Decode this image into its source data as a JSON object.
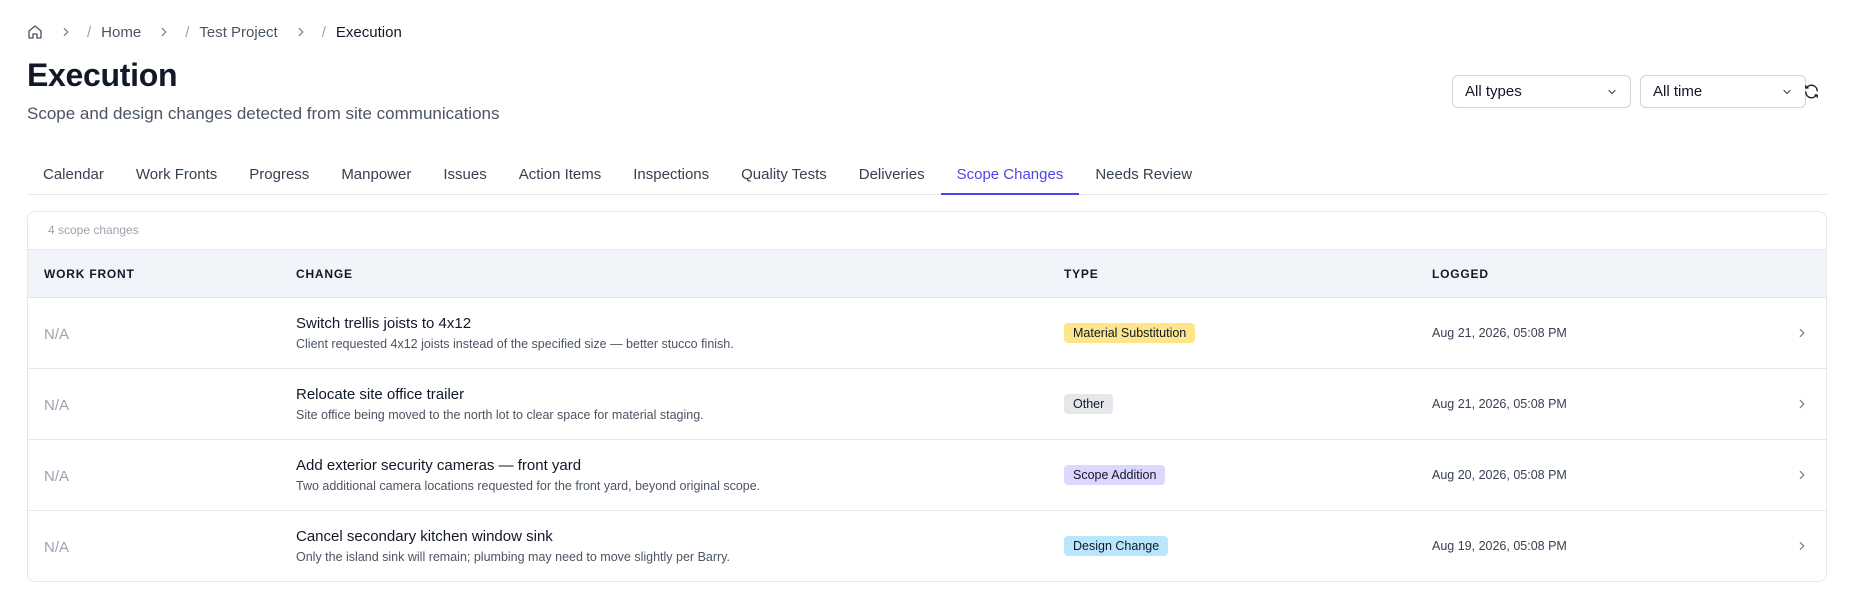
{
  "breadcrumb": {
    "items": [
      {
        "label": "Home"
      },
      {
        "label": "Test Project"
      },
      {
        "label": "Execution"
      }
    ]
  },
  "page": {
    "title": "Execution",
    "subtitle": "Scope and design changes detected from site communications"
  },
  "filters": {
    "type_select": {
      "value": "All types"
    },
    "time_select": {
      "value": "All time"
    }
  },
  "tabs": [
    {
      "label": "Calendar"
    },
    {
      "label": "Work Fronts"
    },
    {
      "label": "Progress"
    },
    {
      "label": "Manpower"
    },
    {
      "label": "Issues"
    },
    {
      "label": "Action Items"
    },
    {
      "label": "Inspections"
    },
    {
      "label": "Quality Tests"
    },
    {
      "label": "Deliveries"
    },
    {
      "label": "Scope Changes",
      "active": true
    },
    {
      "label": "Needs Review"
    }
  ],
  "table": {
    "count_label": "4 scope changes",
    "columns": [
      "WORK FRONT",
      "CHANGE",
      "TYPE",
      "LOGGED"
    ],
    "rows": [
      {
        "work_front": "N/A",
        "title": "Switch trellis joists to 4x12",
        "description": "Client requested 4x12 joists instead of the specified size — better stucco finish.",
        "type": "Material Substitution",
        "logged": "Aug 21, 2026, 05:08 PM"
      },
      {
        "work_front": "N/A",
        "title": "Relocate site office trailer",
        "description": "Site office being moved to the north lot to clear space for material staging.",
        "type": "Other",
        "logged": "Aug 21, 2026, 05:08 PM"
      },
      {
        "work_front": "N/A",
        "title": "Add exterior security cameras — front yard",
        "description": "Two additional camera locations requested for the front yard, beyond original scope.",
        "type": "Scope Addition",
        "logged": "Aug 20, 2026, 05:08 PM"
      },
      {
        "work_front": "N/A",
        "title": "Cancel secondary kitchen window sink",
        "description": "Only the island sink will remain; plumbing may need to move slightly per Barry.",
        "type": "Design Change",
        "logged": "Aug 19, 2026, 05:08 PM"
      }
    ]
  },
  "badge_colors": {
    "Material Substitution": "#fde68a",
    "Other": "#e5e7eb",
    "Scope Addition": "#ddd6fe",
    "Design Change": "#bae6fd"
  },
  "colors": {
    "accent": "#4f46e5"
  },
  "icons": {
    "home": "home-icon",
    "breadcrumb_separator": "chevron-right-icon",
    "select_caret": "chevron-down-icon",
    "refresh": "refresh-icon",
    "row_action": "chevron-right-icon"
  }
}
